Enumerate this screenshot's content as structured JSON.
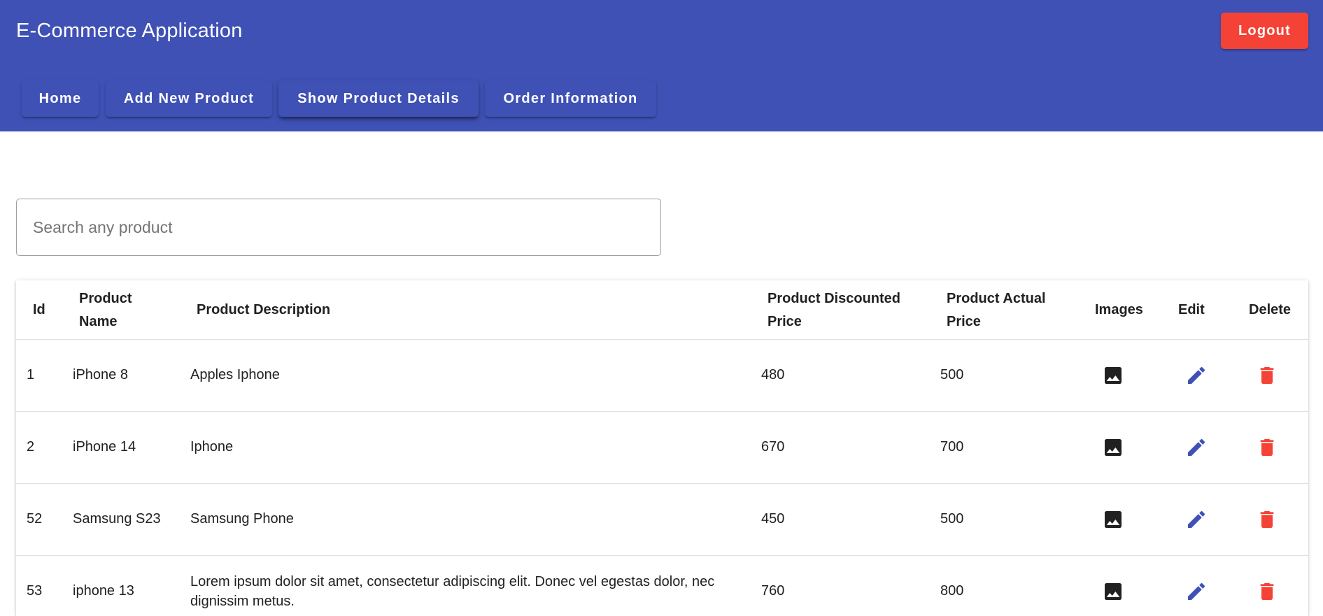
{
  "app": {
    "title": "E-Commerce Application",
    "logout_label": "Logout"
  },
  "nav": {
    "items": [
      {
        "label": "Home"
      },
      {
        "label": "Add New Product"
      },
      {
        "label": "Show Product Details",
        "active": true
      },
      {
        "label": "Order Information"
      }
    ]
  },
  "search": {
    "placeholder": "Search any product",
    "value": ""
  },
  "table": {
    "columns": [
      "Id",
      "Product Name",
      "Product Description",
      "Product Discounted Price",
      "Product Actual Price",
      "Images",
      "Edit",
      "Delete"
    ],
    "rows": [
      {
        "id": "1",
        "name": "iPhone 8",
        "description": "Apples Iphone",
        "discounted": "480",
        "actual": "500"
      },
      {
        "id": "2",
        "name": "iPhone 14",
        "description": "Iphone",
        "discounted": "670",
        "actual": "700"
      },
      {
        "id": "52",
        "name": "Samsung S23",
        "description": "Samsung Phone",
        "discounted": "450",
        "actual": "500"
      },
      {
        "id": "53",
        "name": "iphone 13",
        "description": "Lorem ipsum dolor sit amet, consectetur adipiscing elit. Donec vel egestas dolor, nec dignissim metus.",
        "discounted": "760",
        "actual": "800"
      }
    ],
    "icons": {
      "images": "image-icon",
      "edit": "edit-pencil-icon",
      "delete": "trash-icon"
    }
  },
  "colors": {
    "primary": "#3f51b5",
    "warn": "#f44336",
    "icon_dark": "#212121"
  }
}
